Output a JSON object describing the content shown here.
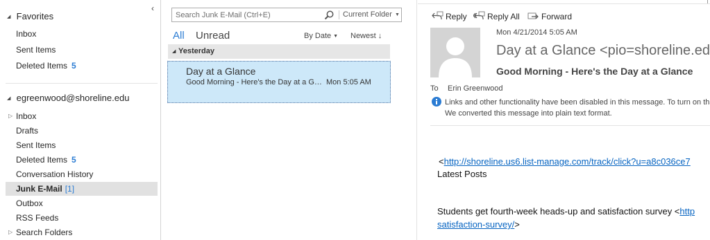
{
  "folder_pane": {
    "collapse_glyph": "‹",
    "favorites": {
      "header": "Favorites",
      "items": [
        {
          "label": "Inbox",
          "count": ""
        },
        {
          "label": "Sent Items",
          "count": ""
        },
        {
          "label": "Deleted Items",
          "count": "5"
        }
      ]
    },
    "account": {
      "header": "egreenwood@shoreline.edu",
      "items": [
        {
          "label": "Inbox",
          "count": ""
        },
        {
          "label": "Drafts",
          "count": ""
        },
        {
          "label": "Sent Items",
          "count": ""
        },
        {
          "label": "Deleted Items",
          "count": "5"
        },
        {
          "label": "Conversation History",
          "count": ""
        },
        {
          "label": "Junk E-Mail",
          "unread": "[1]"
        },
        {
          "label": "Outbox",
          "count": ""
        },
        {
          "label": "RSS Feeds",
          "count": ""
        },
        {
          "label": "Search Folders",
          "count": ""
        }
      ]
    }
  },
  "message_list": {
    "search_placeholder": "Search Junk E-Mail (Ctrl+E)",
    "search_scope": "Current Folder",
    "filters": {
      "all": "All",
      "unread": "Unread"
    },
    "sort_by": "By Date",
    "sort_order": "Newest",
    "group_label": "Yesterday",
    "messages": [
      {
        "from": "Day at a Glance",
        "subject": "Good Morning - Here's the Day at a Glance",
        "time": "Mon 5:05 AM"
      }
    ]
  },
  "reading_pane": {
    "actions": {
      "reply": "Reply",
      "reply_all": "Reply All",
      "forward": "Forward"
    },
    "date": "Mon 4/21/2014 5:05 AM",
    "sender": "Day at a Glance <pio=shoreline.edu@mail.mailchimp.com>",
    "subject": "Good Morning - Here's the Day at a Glance",
    "to_label": "To",
    "to_name": "Erin Greenwood",
    "info_line1": "Links and other functionality have been disabled in this message. To turn on that functionality, move this message to the Inbox.",
    "info_line2": "We converted this message into plain text format.",
    "body": {
      "link1_prefix": "<",
      "link1": "http://shoreline.us6.list-manage.com/track/click?u=a8c036ce7",
      "latest_posts": "Latest Posts",
      "para_text": "Students get fourth-week heads-up and satisfaction survey <",
      "para_link_start": "http",
      "para_link_end": "satisfaction-survey/",
      "para_suffix": ">"
    }
  },
  "colors": {
    "accent": "#2b7cd3",
    "selected_item": "#cde8f9",
    "link": "#0563c1",
    "selected_folder": "#e1e1e1",
    "info_icon": "#2b7cd3"
  },
  "icons": {
    "search": "search-icon",
    "reply": "reply-icon",
    "reply_all": "reply-all-icon",
    "forward": "forward-icon",
    "info": "info-icon",
    "avatar": "person-silhouette-icon"
  }
}
